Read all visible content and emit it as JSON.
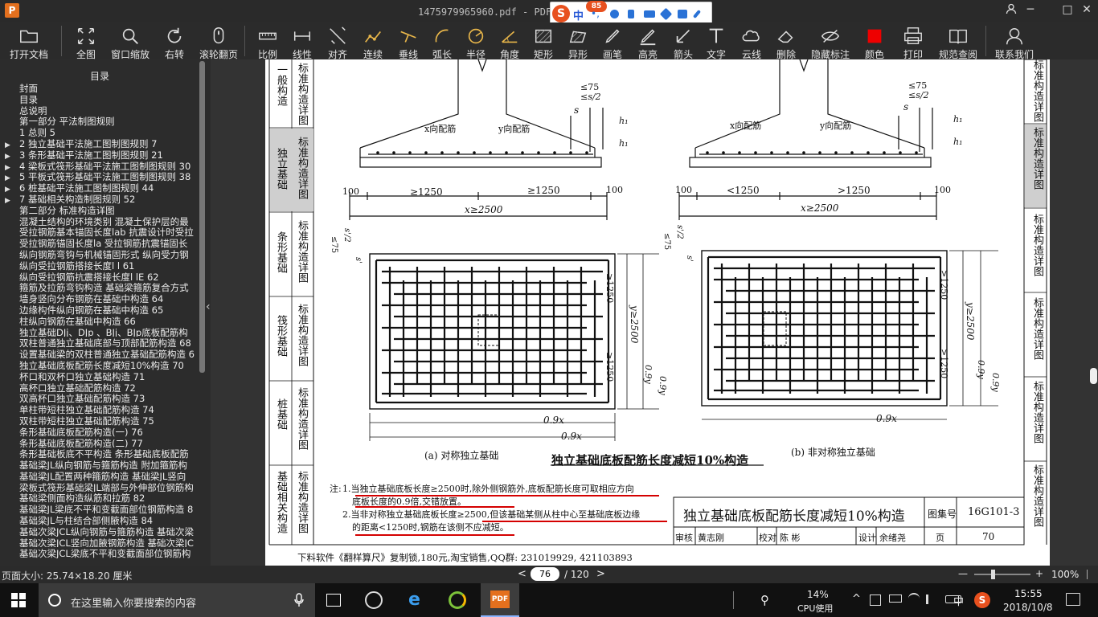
{
  "window": {
    "title": "1475979965960.pdf - PDF 快",
    "app_icon": "P",
    "min": "─",
    "restore": "□",
    "close": "✕",
    "user": "👤"
  },
  "ime": {
    "badge": "85",
    "mode": "中",
    "logo": "S"
  },
  "toolbar": {
    "items": [
      {
        "label": "打开文档",
        "icon": "folder-icon"
      },
      {
        "label": "全图",
        "icon": "fit-page-icon"
      },
      {
        "label": "窗口缩放",
        "icon": "zoom-icon"
      },
      {
        "label": "右转",
        "icon": "rotate-icon"
      },
      {
        "label": "滚轮翻页",
        "icon": "mouse-icon"
      },
      {
        "label": "比例",
        "icon": "scale-icon"
      },
      {
        "label": "线性",
        "icon": "linear-icon"
      },
      {
        "label": "对齐",
        "icon": "align-icon"
      },
      {
        "label": "连续",
        "icon": "continuous-icon"
      },
      {
        "label": "垂线",
        "icon": "perpendicular-icon"
      },
      {
        "label": "弧长",
        "icon": "arc-icon"
      },
      {
        "label": "半径",
        "icon": "radius-icon"
      },
      {
        "label": "角度",
        "icon": "angle-icon"
      },
      {
        "label": "矩形",
        "icon": "rectangle-icon"
      },
      {
        "label": "异形",
        "icon": "polygon-icon"
      },
      {
        "label": "画笔",
        "icon": "pen-icon"
      },
      {
        "label": "高亮",
        "icon": "highlight-icon"
      },
      {
        "label": "箭头",
        "icon": "arrow-icon"
      },
      {
        "label": "文字",
        "icon": "text-icon"
      },
      {
        "label": "云线",
        "icon": "cloud-icon"
      },
      {
        "label": "删除",
        "icon": "eraser-icon"
      },
      {
        "label": "隐藏标注",
        "icon": "eye-hide-icon"
      },
      {
        "label": "颜色",
        "icon": "color-icon"
      },
      {
        "label": "打印",
        "icon": "print-icon"
      },
      {
        "label": "规范查阅",
        "icon": "book-icon"
      },
      {
        "label": "联系我们",
        "icon": "contact-icon"
      }
    ]
  },
  "sidebar": {
    "title": "目录",
    "items": [
      {
        "text": "封面",
        "arrow": ""
      },
      {
        "text": "目录",
        "arrow": ""
      },
      {
        "text": "总说明",
        "arrow": ""
      },
      {
        "text": "第一部分  平法制图规则",
        "arrow": ""
      },
      {
        "text": "1  总则  5",
        "arrow": ""
      },
      {
        "text": "2  独立基础平法施工图制图规则  7",
        "arrow": "▶"
      },
      {
        "text": "3  条形基础平法施工图制图规则  21",
        "arrow": "▶"
      },
      {
        "text": "4  梁板式筏形基础平法施工图制图规则  30",
        "arrow": "▶"
      },
      {
        "text": "5  平板式筏形基础平法施工图制图规则  38",
        "arrow": "▶"
      },
      {
        "text": "6  桩基础平法施工图制图规则  44",
        "arrow": "▶"
      },
      {
        "text": "7  基础相关构造制图规则  52",
        "arrow": "▶"
      },
      {
        "text": "第二部分  标准构造详图",
        "arrow": ""
      },
      {
        "text": "混凝土结构的环境类别  混凝土保护层的最",
        "arrow": ""
      },
      {
        "text": "受拉钢筋基本锚固长度lab  抗震设计时受拉",
        "arrow": ""
      },
      {
        "text": "受拉钢筋锚固长度la  受拉钢筋抗震锚固长",
        "arrow": ""
      },
      {
        "text": "纵向钢筋弯钩与机械锚固形式  纵向受力钢",
        "arrow": ""
      },
      {
        "text": "纵向受拉钢筋搭接长度l l  61",
        "arrow": ""
      },
      {
        "text": "纵向受拉钢筋抗震搭接长度l lE  62",
        "arrow": ""
      },
      {
        "text": "箍筋及拉筋弯钩构造  基础梁箍筋复合方式",
        "arrow": ""
      },
      {
        "text": "墙身竖向分布钢筋在基础中构造  64",
        "arrow": ""
      },
      {
        "text": "边缘构件纵向钢筋在基础中构造  65",
        "arrow": ""
      },
      {
        "text": "柱纵向钢筋在基础中构造  66",
        "arrow": ""
      },
      {
        "text": "独立基础DJj、DJp 、BJj、BJp底板配筋构",
        "arrow": ""
      },
      {
        "text": "双柱普通独立基础底部与顶部配筋构造  68",
        "arrow": ""
      },
      {
        "text": "设置基础梁的双柱普通独立基础配筋构造  6",
        "arrow": ""
      },
      {
        "text": "独立基础底板配筋长度减短10%构造  70",
        "arrow": ""
      },
      {
        "text": "杯口和双杯口独立基础构造  71",
        "arrow": ""
      },
      {
        "text": "高杯口独立基础配筋构造  72",
        "arrow": ""
      },
      {
        "text": "双高杯口独立基础配筋构造  73",
        "arrow": ""
      },
      {
        "text": "单柱带短柱独立基础配筋构造  74",
        "arrow": ""
      },
      {
        "text": "双柱带短柱独立基础配筋构造  75",
        "arrow": ""
      },
      {
        "text": "条形基础底板配筋构造(一)  76",
        "arrow": ""
      },
      {
        "text": "条形基础底板配筋构造(二)  77",
        "arrow": ""
      },
      {
        "text": "条形基础板底不平构造  条形基础底板配筋",
        "arrow": ""
      },
      {
        "text": "基础梁JL纵向钢筋与箍筋构造  附加箍筋构",
        "arrow": ""
      },
      {
        "text": "基础梁JL配置两种箍筋构造  基础梁JL竖向",
        "arrow": ""
      },
      {
        "text": "梁板式筏形基础梁JL端部与外伸部位钢筋构",
        "arrow": ""
      },
      {
        "text": "基础梁侧面构造纵筋和拉筋  82",
        "arrow": ""
      },
      {
        "text": "基础梁JL梁底不平和变截面部位钢筋构造  8",
        "arrow": ""
      },
      {
        "text": "基础梁JL与柱结合部侧腋构造  84",
        "arrow": ""
      },
      {
        "text": "基础次梁JCL纵向钢筋与箍筋构造  基础次梁",
        "arrow": ""
      },
      {
        "text": "基础次梁JCL竖向加腋钢筋构造  基础次梁JC",
        "arrow": ""
      },
      {
        "text": "基础次梁JCL梁底不平和变截面部位钢筋构",
        "arrow": ""
      }
    ]
  },
  "page": {
    "left_tabs": [
      "一般构造",
      "标准构造详图",
      "独立基础",
      "标准构造详图",
      "条形基础",
      "标准构造详图",
      "筏形基础",
      "标准构造详图",
      "桩基础",
      "标准构造详图",
      "基础相关构造",
      "标准构造详图"
    ],
    "right_tabs": [
      "标准构造详图",
      "标准构造详图",
      "标准构造详图",
      "标准构造详图",
      "标准构造详图",
      "标准构造详图"
    ],
    "dims_a": {
      "le75": "≤75",
      "le_s2": "≤s/2",
      "s": "s",
      "h1": "h₁",
      "h1b": "h₁",
      "x_bar": "x向配筋",
      "y_bar": "y向配筋",
      "d100l": "100",
      "d100r": "100",
      "ge1250a": "≥1250",
      "ge1250b": "≥1250",
      "x_ge": "x≥2500"
    },
    "dims_b": {
      "le75": "≤75",
      "le_s2": "≤s/2",
      "s": "s",
      "h1": "h₁",
      "h1b": "h₁",
      "x_bar": "x向配筋",
      "y_bar": "y向配筋",
      "d100l": "100",
      "d100r": "100",
      "lt1250": "<1250",
      "ge1250": ">1250",
      "x_ge": "x≥2500"
    },
    "plan_a": {
      "le75": "≤75",
      "s2": "s'/2",
      "s": "s'",
      "v1250a": "≥1250",
      "v1250b": "≥1250",
      "y_ge": "y≥2500",
      "y09a": "0.9y",
      "y09b": "0.9y",
      "x09a": "0.9x",
      "x09b": "0.9x"
    },
    "plan_b": {
      "le75": "≤75",
      "s2": "s'/2",
      "s": "s'",
      "v1250a": ">1250",
      "v1250b": ">1250",
      "y_ge": "y≥2500",
      "y09a": "0.9y",
      "y09b": "0.9y",
      "x09a": "0.9x"
    },
    "caption_a": "(a)  对称独立基础",
    "caption_b": "(b)  非对称独立基础",
    "main_caption": "独立基础底板配筋长度减短10%构造",
    "note_label": "注:",
    "note1_a": "1.当独立基础底板长度≥2500时,除外侧钢筋外,底板配筋长度可取相应方向",
    "note1_b": "底板长度的0.9倍,交错放置。",
    "note2_a": "2.当非对称独立基础底板长度≥2500,但该基础某侧从柱中心至基础底板边缘",
    "note2_b": "的距离<1250时,钢筋在该侧不应减短。",
    "titleblock": {
      "title": "独立基础底板配筋长度减短10%构造",
      "set_label": "图集号",
      "set_no": "16G101-3",
      "review": "审核",
      "reviewer": "黄志刚",
      "check": "校对",
      "checker": "陈  彬",
      "design": "设计",
      "designer": "余绪尧",
      "page_label": "页",
      "page_no": "70"
    },
    "footer": "下料软件《翻样算尺》复制锁,180元,淘宝销售,QQ群: 231019929, 421103893"
  },
  "status": {
    "page_size": "页面大小: 25.74×18.20 厘米",
    "current_page": "76",
    "total_pages": "/ 120",
    "zoom": "100%",
    "prev": "<",
    "next": ">",
    "zoom_out": "—",
    "zoom_in": "+"
  },
  "taskbar": {
    "search_placeholder": "在这里输入你要搜索的内容",
    "cpu": "14%",
    "cpu_label": "CPU使用",
    "time": "15:55",
    "date": "2018/10/8",
    "ime": "中",
    "app_label": "PDF"
  }
}
